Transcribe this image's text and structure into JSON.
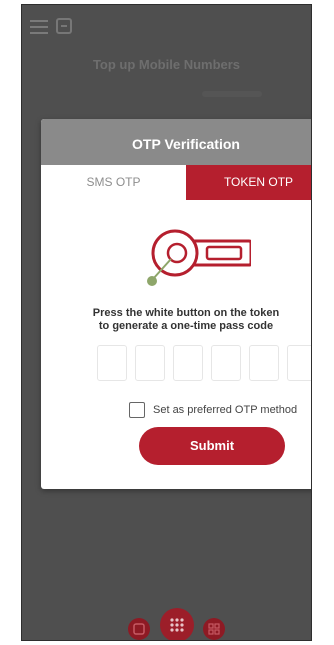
{
  "background_page": {
    "title": "Top up Mobile Numbers"
  },
  "modal": {
    "title": "OTP Verification",
    "tabs": [
      {
        "label": "SMS OTP",
        "active": false
      },
      {
        "label": "TOKEN OTP",
        "active": true
      }
    ],
    "instruction_line1": "Press the white button on the token",
    "instruction_line2": "to generate a one-time pass code",
    "otp_digits": [
      "",
      "",
      "",
      "",
      "",
      ""
    ],
    "preferred_label": "Set as preferred OTP method",
    "preferred_checked": false,
    "submit_label": "Submit"
  },
  "colors": {
    "accent": "#b51f2e",
    "header_gray": "#8a8a8a",
    "overlay": "#4f4f4f",
    "token_dot": "#8ea66a"
  },
  "icons": {
    "menu": "hamburger-icon",
    "language": "language-icon",
    "token": "token-device-icon",
    "nav_left": "nav-left-icon",
    "nav_center": "grid-icon",
    "nav_right": "nav-right-icon"
  }
}
